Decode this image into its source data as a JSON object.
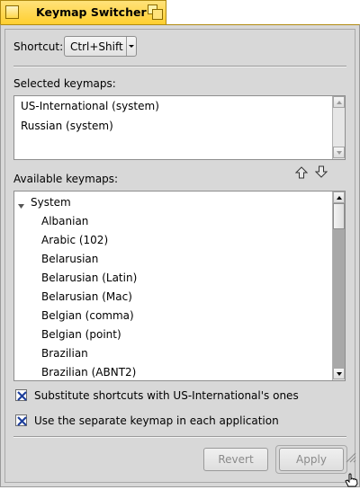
{
  "window": {
    "title": "Keymap Switcher"
  },
  "shortcut": {
    "label": "Shortcut:",
    "value": "Ctrl+Shift"
  },
  "selected": {
    "label": "Selected keymaps:",
    "items": [
      "US-International (system)",
      "Russian (system)"
    ]
  },
  "move_icons": {
    "up": "arrow-up-icon",
    "down": "arrow-down-icon"
  },
  "available": {
    "label": "Available keymaps:",
    "group": "System",
    "items": [
      "Albanian",
      "Arabic (102)",
      "Belarusian",
      "Belarusian (Latin)",
      "Belarusian (Mac)",
      "Belgian (comma)",
      "Belgian (point)",
      "Brazilian",
      "Brazilian (ABNT2)"
    ]
  },
  "options": {
    "substitute": "Substitute shortcuts with US-International's ones",
    "separate": "Use the separate keymap in each application",
    "substitute_checked": true,
    "separate_checked": true
  },
  "buttons": {
    "revert": "Revert",
    "apply": "Apply"
  },
  "colors": {
    "tab": "#ffd84a",
    "panel": "#d8d8d8",
    "check": "#1e3f9c",
    "disabled_text": "#8a8a8a"
  }
}
